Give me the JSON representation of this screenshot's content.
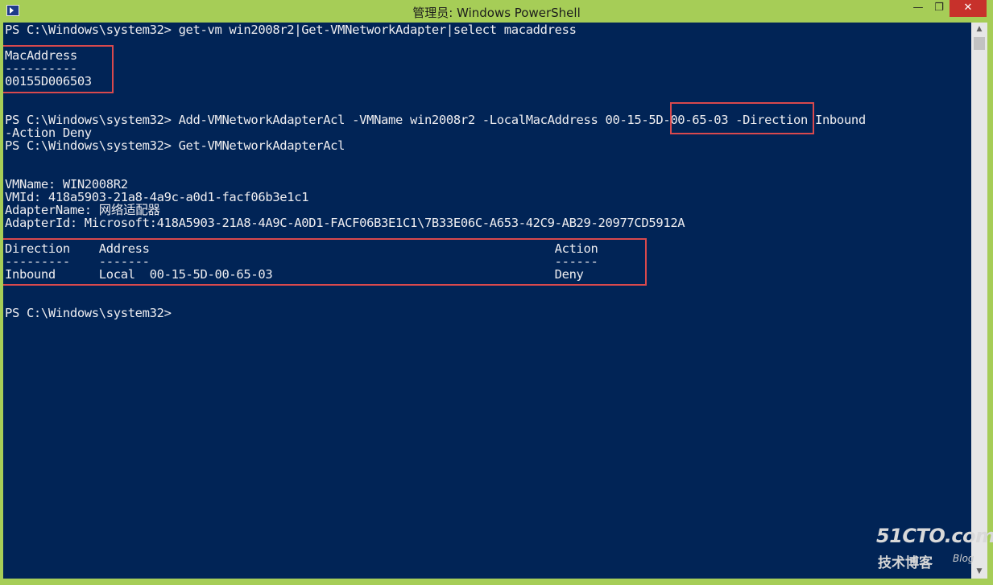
{
  "window": {
    "title": "管理员: Windows PowerShell",
    "minimize_glyph": "—",
    "maximize_glyph": "❐",
    "close_glyph": "✕"
  },
  "console": {
    "lines": [
      "PS C:\\Windows\\system32> get-vm win2008r2|Get-VMNetworkAdapter|select macaddress",
      "",
      "MacAddress",
      "----------",
      "00155D006503",
      "",
      "",
      "PS C:\\Windows\\system32> Add-VMNetworkAdapterAcl -VMName win2008r2 -LocalMacAddress 00-15-5D-00-65-03 -Direction Inbound",
      "-Action Deny",
      "PS C:\\Windows\\system32> Get-VMNetworkAdapterAcl",
      "",
      "",
      "VMName: WIN2008R2",
      "VMId: 418a5903-21a8-4a9c-a0d1-facf06b3e1c1",
      "AdapterName: 网络适配器",
      "AdapterId: Microsoft:418A5903-21A8-4A9C-A0D1-FACF06B3E1C1\\7B33E06C-A653-42C9-AB29-20977CD5912A",
      "Direction    Address                                                        Action",
      "---------    -------                                                        ------",
      "Inbound      Local  00-15-5D-00-65-03                                       Deny",
      "",
      "",
      "PS C:\\Windows\\system32>"
    ]
  },
  "watermark": {
    "main": "51CTO.com",
    "sub": "技术博客",
    "blog": "Blog"
  }
}
